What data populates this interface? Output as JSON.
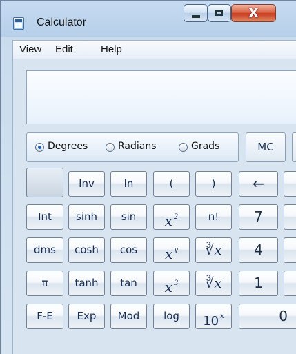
{
  "window": {
    "title": "Calculator",
    "controls": {
      "minimize": "",
      "maximize": "",
      "close": "X"
    }
  },
  "menu": [
    "View",
    "Edit",
    "Help"
  ],
  "display": {
    "value": ""
  },
  "angle_mode": {
    "selected": "Degrees",
    "options": [
      "Degrees",
      "Radians",
      "Grads"
    ]
  },
  "memory": {
    "mc": "MC"
  },
  "buttons": {
    "row1": [
      "",
      "Inv",
      "ln",
      "(",
      ")",
      "←"
    ],
    "row2": [
      "Int",
      "sinh",
      "sin",
      "x",
      "2",
      "n!",
      "7"
    ],
    "row3": [
      "dms",
      "cosh",
      "cos",
      "x",
      "y",
      "∛x",
      "4"
    ],
    "row4": [
      "π",
      "tanh",
      "tan",
      "x",
      "3",
      "∛x",
      "1"
    ],
    "row5": [
      "F-E",
      "Exp",
      "Mod",
      "log",
      "10",
      "x",
      "0"
    ]
  },
  "colors": {
    "window_blue": "#b9d1ea",
    "button_text": "#162c51",
    "close_red": "#c73b1e"
  }
}
